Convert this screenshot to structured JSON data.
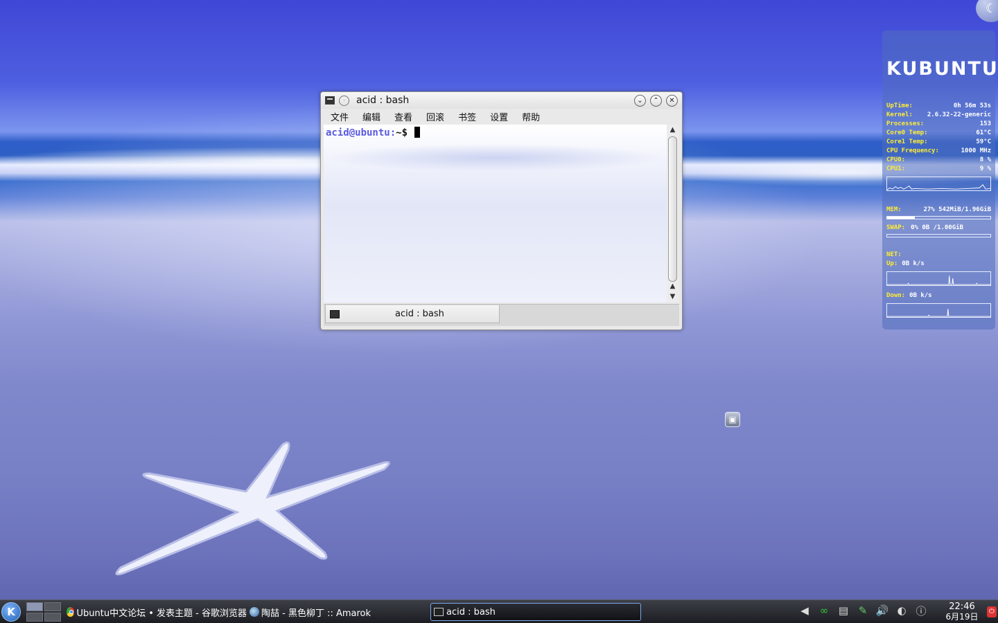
{
  "terminal": {
    "title": "acid : bash",
    "menu": [
      "文件",
      "编辑",
      "查看",
      "回滚",
      "书签",
      "设置",
      "帮助"
    ],
    "prompt_user": "acid@ubuntu:",
    "prompt_tail": "~$",
    "tab_label": "acid : bash"
  },
  "conky": {
    "logo": "KUBUNTU",
    "rows": [
      {
        "key": "UpTime:",
        "value": "0h 56m 53s"
      },
      {
        "key": "Kernel:",
        "value": "2.6.32-22-generic"
      },
      {
        "key": "Processes:",
        "value": "153"
      },
      {
        "key": "Core0 Temp:",
        "value": "61°C"
      },
      {
        "key": "Core1 Temp:",
        "value": "59°C"
      },
      {
        "key": "CPU Frequency:",
        "value": "1000 MHz"
      },
      {
        "key": "CPU0:",
        "value": "8 %"
      },
      {
        "key": "CPU1:",
        "value": "9 %"
      }
    ],
    "mem_label": "MEM:",
    "mem_value": "27% 542MiB/1.96GiB",
    "mem_fraction": 0.27,
    "swap_label": "SWAP:",
    "swap_value": "0% 0B  /1.00GiB",
    "swap_fraction": 0,
    "net_label": "NET:",
    "up_label": "Up:",
    "up_value": "0B   k/s",
    "down_label": "Down:",
    "down_value": "0B  k/s"
  },
  "taskbar": {
    "tasks": [
      {
        "label": "Ubuntu中文论坛 • 发表主题 - 谷歌浏览器",
        "icon": "chrome-icon"
      },
      {
        "label": "陶喆 - 黑色柳丁  ::  Amarok",
        "icon": "amarok-icon"
      },
      {
        "label": "acid : bash",
        "icon": "terminal-icon",
        "active": true
      }
    ],
    "clock_time": "22:46",
    "clock_date": "6月19日"
  }
}
